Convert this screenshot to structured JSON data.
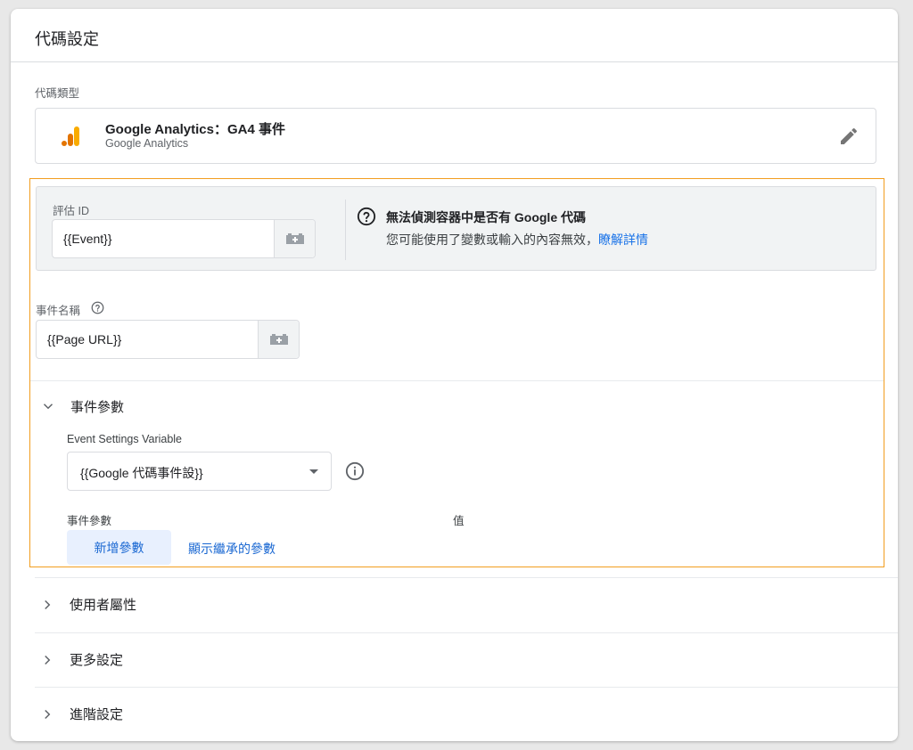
{
  "header": {
    "title": "代碼設定"
  },
  "tag_type": {
    "section_label": "代碼類型",
    "title": "Google Analytics：GA4 事件",
    "subtitle": "Google Analytics",
    "icon": "google-analytics-bars-icon",
    "edit_icon": "pencil-icon"
  },
  "measurement_id": {
    "label": "評估 ID",
    "value": "{{Event}}",
    "variable_button_icon": "variable-block-icon"
  },
  "warning": {
    "icon": "help-circle-icon",
    "title": "無法偵測容器中是否有 Google 代碼",
    "text": "您可能使用了變數或輸入的內容無效，",
    "link": "瞭解詳情"
  },
  "event_name": {
    "label": "事件名稱",
    "value": "{{Page URL}}",
    "help_icon": "help-circle-icon"
  },
  "event_params": {
    "section_label": "事件參數",
    "settings_variable_label": "Event Settings Variable",
    "settings_variable_value": "{{Google 代碼事件設}}",
    "col_param": "事件參數",
    "col_value": "值",
    "add_button": "新增參數",
    "show_inherited_link": "顯示繼承的參數"
  },
  "collapsed_sections": [
    {
      "label": "使用者屬性"
    },
    {
      "label": "更多設定"
    },
    {
      "label": "進階設定"
    }
  ],
  "colors": {
    "highlight_border": "#f29d1f",
    "link": "#1967d2",
    "ga_orange": "#f9ab00",
    "ga_dark_orange": "#e37400"
  }
}
